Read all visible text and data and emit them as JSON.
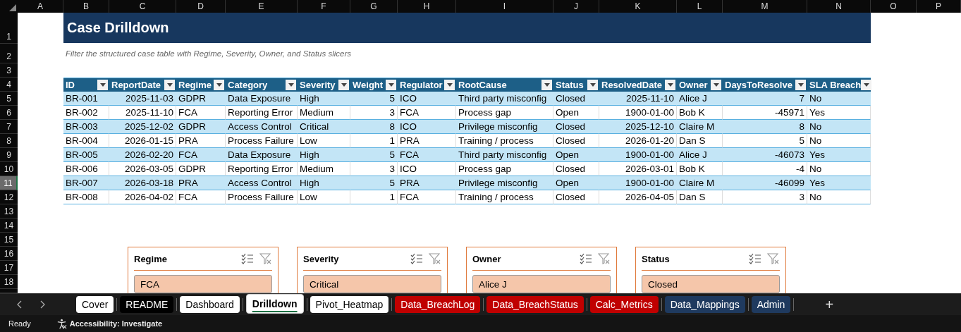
{
  "column_headers": [
    "A",
    "B",
    "C",
    "D",
    "E",
    "F",
    "G",
    "H",
    "I",
    "J",
    "K",
    "L",
    "M",
    "N",
    "O",
    "P"
  ],
  "row_headers": [
    {
      "label": "1",
      "selected": false
    },
    {
      "label": "2",
      "selected": false
    },
    {
      "label": "3",
      "selected": false
    },
    {
      "label": "4",
      "selected": false
    },
    {
      "label": "5",
      "selected": false
    },
    {
      "label": "6",
      "selected": false
    },
    {
      "label": "7",
      "selected": false
    },
    {
      "label": "8",
      "selected": false
    },
    {
      "label": "9",
      "selected": false
    },
    {
      "label": "10",
      "selected": false
    },
    {
      "label": "11",
      "selected": true
    },
    {
      "label": "12",
      "selected": false
    },
    {
      "label": "13",
      "selected": false
    },
    {
      "label": "14",
      "selected": false
    },
    {
      "label": "15",
      "selected": false
    },
    {
      "label": "16",
      "selected": false
    },
    {
      "label": "17",
      "selected": false
    },
    {
      "label": "18",
      "selected": false
    }
  ],
  "title": "Case Drilldown",
  "subtitle": "Filter the structured case table with Regime, Severity, Owner, and Status slicers",
  "table": {
    "columns": [
      {
        "label": "ID",
        "kind": "text"
      },
      {
        "label": "ReportDate",
        "kind": "number"
      },
      {
        "label": "Regime",
        "kind": "text"
      },
      {
        "label": "Category",
        "kind": "text"
      },
      {
        "label": "Severity",
        "kind": "text"
      },
      {
        "label": "Weight",
        "kind": "number"
      },
      {
        "label": "Regulator",
        "kind": "text"
      },
      {
        "label": "RootCause",
        "kind": "text"
      },
      {
        "label": "Status",
        "kind": "text"
      },
      {
        "label": "ResolvedDate",
        "kind": "number"
      },
      {
        "label": "Owner",
        "kind": "text"
      },
      {
        "label": "DaysToResolve",
        "kind": "number"
      },
      {
        "label": "SLA Breach",
        "kind": "text"
      }
    ],
    "rows": [
      [
        "BR-001",
        "2025-11-03",
        "GDPR",
        "Data Exposure",
        "High",
        "5",
        "ICO",
        "Third party misconfig",
        "Closed",
        "2025-11-10",
        "Alice J",
        "7",
        "No"
      ],
      [
        "BR-002",
        "2025-11-10",
        "FCA",
        "Reporting Error",
        "Medium",
        "3",
        "FCA",
        "Process gap",
        "Open",
        "1900-01-00",
        "Bob K",
        "-45971",
        "Yes"
      ],
      [
        "BR-003",
        "2025-12-02",
        "GDPR",
        "Access Control",
        "Critical",
        "8",
        "ICO",
        "Privilege misconfig",
        "Closed",
        "2025-12-10",
        "Claire M",
        "8",
        "No"
      ],
      [
        "BR-004",
        "2026-01-15",
        "PRA",
        "Process Failure",
        "Low",
        "1",
        "PRA",
        "Training / process",
        "Closed",
        "2026-01-20",
        "Dan S",
        "5",
        "No"
      ],
      [
        "BR-005",
        "2026-02-20",
        "FCA",
        "Data Exposure",
        "High",
        "5",
        "FCA",
        "Third party misconfig",
        "Open",
        "1900-01-00",
        "Alice J",
        "-46073",
        "Yes"
      ],
      [
        "BR-006",
        "2026-03-05",
        "GDPR",
        "Reporting Error",
        "Medium",
        "3",
        "ICO",
        "Process gap",
        "Closed",
        "2026-03-01",
        "Bob K",
        "-4",
        "No"
      ],
      [
        "BR-007",
        "2026-03-18",
        "PRA",
        "Access Control",
        "High",
        "5",
        "PRA",
        "Privilege misconfig",
        "Open",
        "1900-01-00",
        "Claire M",
        "-46099",
        "Yes"
      ],
      [
        "BR-008",
        "2026-04-02",
        "FCA",
        "Process Failure",
        "Low",
        "1",
        "FCA",
        "Training / process",
        "Closed",
        "2026-04-05",
        "Dan S",
        "3",
        "No"
      ]
    ]
  },
  "slicers": [
    {
      "title": "Regime",
      "items": [
        {
          "label": "FCA",
          "selected": true
        }
      ]
    },
    {
      "title": "Severity",
      "items": [
        {
          "label": "Critical",
          "selected": true
        }
      ]
    },
    {
      "title": "Owner",
      "items": [
        {
          "label": "Alice J",
          "selected": true
        }
      ]
    },
    {
      "title": "Status",
      "items": [
        {
          "label": "Closed",
          "selected": true
        }
      ]
    }
  ],
  "sheet_tabs": [
    {
      "label": "Cover",
      "color": "#ffffff",
      "selected": false
    },
    {
      "label": "README",
      "color": "#000000",
      "selected": false
    },
    {
      "label": "Dashboard",
      "color": "#ffffff",
      "selected": false
    },
    {
      "label": "Drilldown",
      "color": "#ffffff",
      "selected": true
    },
    {
      "label": "Pivot_Heatmap",
      "color": "#ffffff",
      "selected": false
    },
    {
      "label": "Data_BreachLog",
      "color": "#c00000",
      "selected": false
    },
    {
      "label": "Data_BreachStatus",
      "color": "#c00000",
      "selected": false
    },
    {
      "label": "Calc_Metrics",
      "color": "#c00000",
      "selected": false
    },
    {
      "label": "Data_Mappings",
      "color": "#1f3a5f",
      "selected": false
    },
    {
      "label": "Admin",
      "color": "#1f3a5f",
      "selected": false
    }
  ],
  "add_sheet": "+",
  "status_bar": {
    "mode": "Ready",
    "accessibility": "Accessibility: Investigate"
  }
}
